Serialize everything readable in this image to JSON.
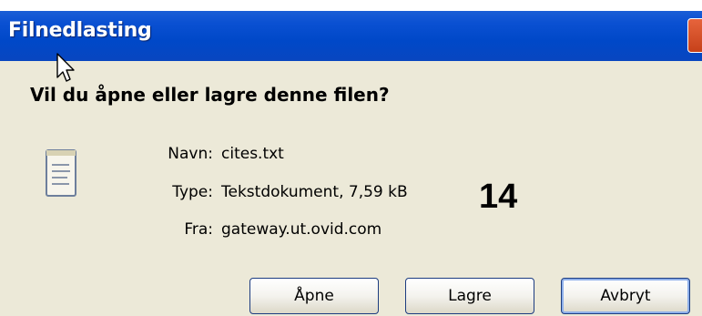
{
  "dialog": {
    "title": "Filnedlasting",
    "question": "Vil du åpne eller lagre denne filen?",
    "fields": [
      {
        "label": "Navn:",
        "value": "cites.txt"
      },
      {
        "label": "Type:",
        "value": "Tekstdokument, 7,59 kB"
      },
      {
        "label": "Fra:",
        "value": "gateway.ut.ovid.com"
      }
    ],
    "buttons": {
      "open": "Åpne",
      "save": "Lagre",
      "cancel": "Avbryt"
    }
  },
  "annotation_number": "14",
  "icons": {
    "file": "text-file-icon",
    "close": "close-icon",
    "cursor": "mouse-pointer-icon"
  },
  "colors": {
    "titlebar": "#0a50d2",
    "dialog_bg": "#ece9d8",
    "close": "#d9532b"
  }
}
